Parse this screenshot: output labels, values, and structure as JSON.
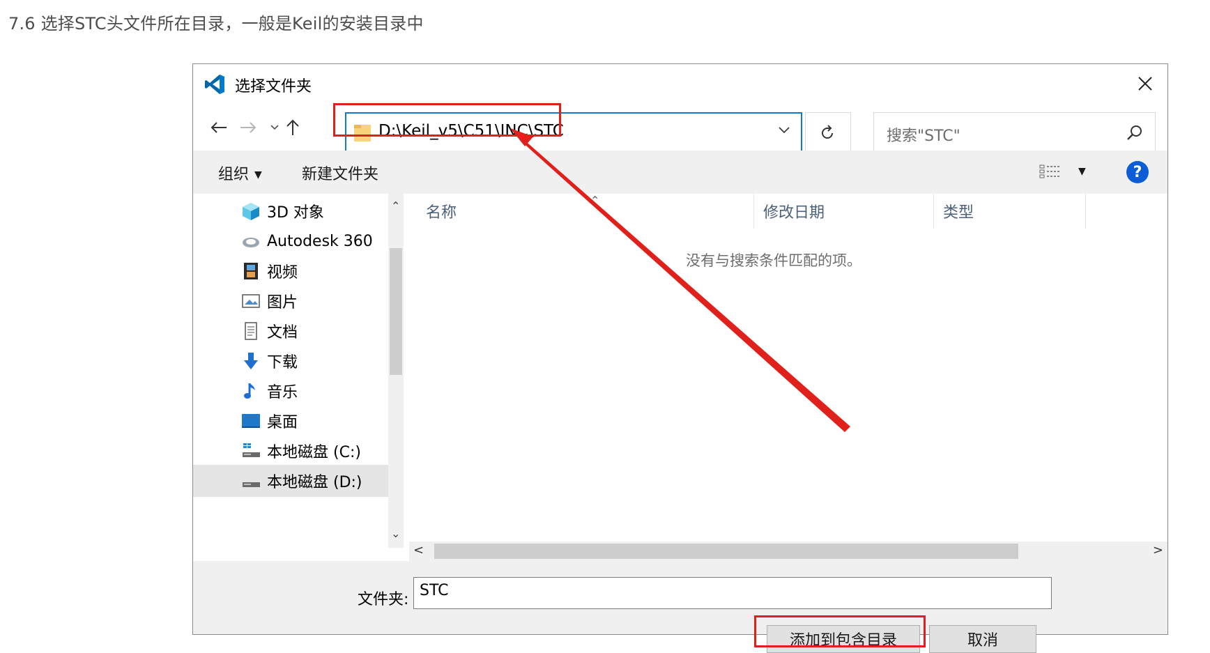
{
  "heading": "7.6 选择STC头文件所在目录，一般是Keil的安装目录中",
  "dialog": {
    "title": "选择文件夹",
    "address": "D:\\Keil_v5\\C51\\INC\\STC",
    "search_placeholder": "搜索\"STC\"",
    "toolbar": {
      "organize": "组织",
      "new_folder": "新建文件夹"
    },
    "nav_items": [
      {
        "label": "3D 对象",
        "icon": "cube-icon"
      },
      {
        "label": "Autodesk 360",
        "icon": "cloud-icon"
      },
      {
        "label": "视频",
        "icon": "video-icon"
      },
      {
        "label": "图片",
        "icon": "picture-icon"
      },
      {
        "label": "文档",
        "icon": "document-icon"
      },
      {
        "label": "下载",
        "icon": "download-icon"
      },
      {
        "label": "音乐",
        "icon": "music-icon"
      },
      {
        "label": "桌面",
        "icon": "desktop-icon"
      },
      {
        "label": "本地磁盘 (C:)",
        "icon": "drive-icon"
      },
      {
        "label": "本地磁盘 (D:)",
        "icon": "drive-icon"
      }
    ],
    "columns": {
      "name": "名称",
      "modified": "修改日期",
      "type": "类型"
    },
    "empty_message": "没有与搜索条件匹配的项。",
    "folder_label": "文件夹:",
    "folder_value": "STC",
    "buttons": {
      "add": "添加到包含目录",
      "cancel": "取消"
    }
  },
  "colors": {
    "accent": "#0b78d4",
    "annotation": "#e0201b"
  }
}
